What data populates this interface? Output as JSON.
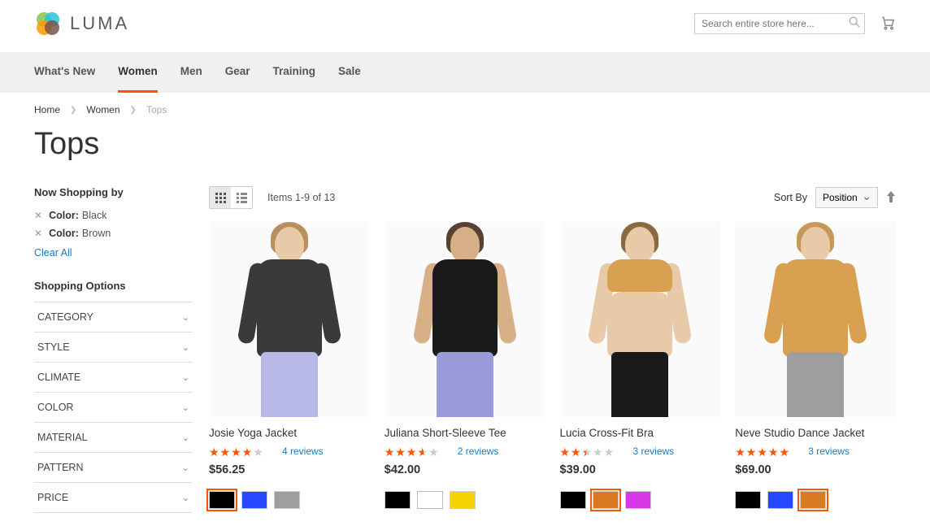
{
  "header": {
    "logo_text": "LUMA",
    "search_placeholder": "Search entire store here..."
  },
  "nav": {
    "items": [
      "What's New",
      "Women",
      "Men",
      "Gear",
      "Training",
      "Sale"
    ],
    "active_index": 1
  },
  "breadcrumbs": {
    "items": [
      "Home",
      "Women",
      "Tops"
    ]
  },
  "page_title": "Tops",
  "sidebar": {
    "now_shopping_title": "Now Shopping by",
    "active_filters": [
      {
        "label": "Color:",
        "value": "Black"
      },
      {
        "label": "Color:",
        "value": "Brown"
      }
    ],
    "clear_all_label": "Clear All",
    "shopping_options_title": "Shopping Options",
    "options": [
      "CATEGORY",
      "STYLE",
      "CLIMATE",
      "COLOR",
      "MATERIAL",
      "PATTERN",
      "PRICE"
    ]
  },
  "toolbar": {
    "item_count_text": "Items 1-9 of 13",
    "sort_by_label": "Sort By",
    "sort_value": "Position"
  },
  "products": [
    {
      "name": "Josie Yoga Jacket",
      "price": "$56.25",
      "rating_pct": 70,
      "reviews_text": "4 reviews",
      "swatches": [
        "#000000",
        "#2447ff",
        "#9e9e9e"
      ],
      "selected_swatch": 0,
      "model": {
        "top": "#3a3a3a",
        "bottom": "#b8b8e8",
        "skin": "#e8c9a8",
        "hair": "#b8905d",
        "sleeves": true
      }
    },
    {
      "name": "Juliana Short-Sleeve Tee",
      "price": "$42.00",
      "rating_pct": 60,
      "reviews_text": "2 reviews",
      "swatches": [
        "#000000",
        "#ffffff",
        "#f5d300"
      ],
      "selected_swatch": -1,
      "model": {
        "top": "#1a1a1a",
        "bottom": "#9a9ad8",
        "skin": "#d8b088",
        "hair": "#5a4030",
        "sleeves": false
      }
    },
    {
      "name": "Lucia Cross-Fit Bra",
      "price": "$39.00",
      "rating_pct": 40,
      "reviews_text": "3 reviews",
      "swatches": [
        "#000000",
        "#d87a1f",
        "#d838e8"
      ],
      "selected_swatch": 1,
      "model": {
        "top": "#d8a050",
        "bottom": "#1a1a1a",
        "skin": "#e8c9a8",
        "hair": "#8a6840",
        "sleeves": false,
        "short_top": true
      }
    },
    {
      "name": "Neve Studio Dance Jacket",
      "price": "$69.00",
      "rating_pct": 85,
      "reviews_text": "3 reviews",
      "swatches": [
        "#000000",
        "#2447ff",
        "#d87a1f"
      ],
      "selected_swatch": 2,
      "model": {
        "top": "#d8a050",
        "bottom": "#9e9e9e",
        "skin": "#e8c9a8",
        "hair": "#c89858",
        "sleeves": true
      }
    }
  ]
}
